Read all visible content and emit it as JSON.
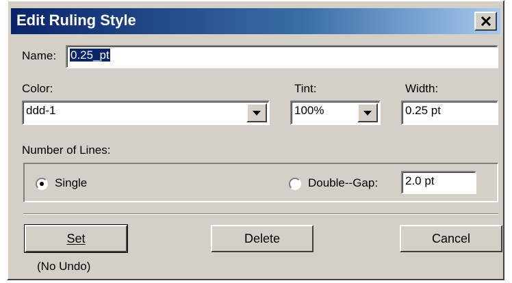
{
  "window": {
    "title": "Edit Ruling Style"
  },
  "name_field": {
    "label": "Name:",
    "value": "0.25_pt"
  },
  "color": {
    "label": "Color:",
    "value": "ddd-1"
  },
  "tint": {
    "label": "Tint:",
    "value": "100%"
  },
  "width": {
    "label": "Width:",
    "value": "0.25 pt"
  },
  "lines": {
    "label": "Number of Lines:",
    "single_label": "Single",
    "double_label": "Double--Gap:",
    "gap_value": "2.0 pt",
    "selected": "single"
  },
  "buttons": {
    "set": "Set",
    "delete": "Delete",
    "cancel": "Cancel"
  },
  "note": "(No Undo)",
  "icons": {
    "close": "close-icon",
    "dropdown": "chevron-down-icon"
  }
}
